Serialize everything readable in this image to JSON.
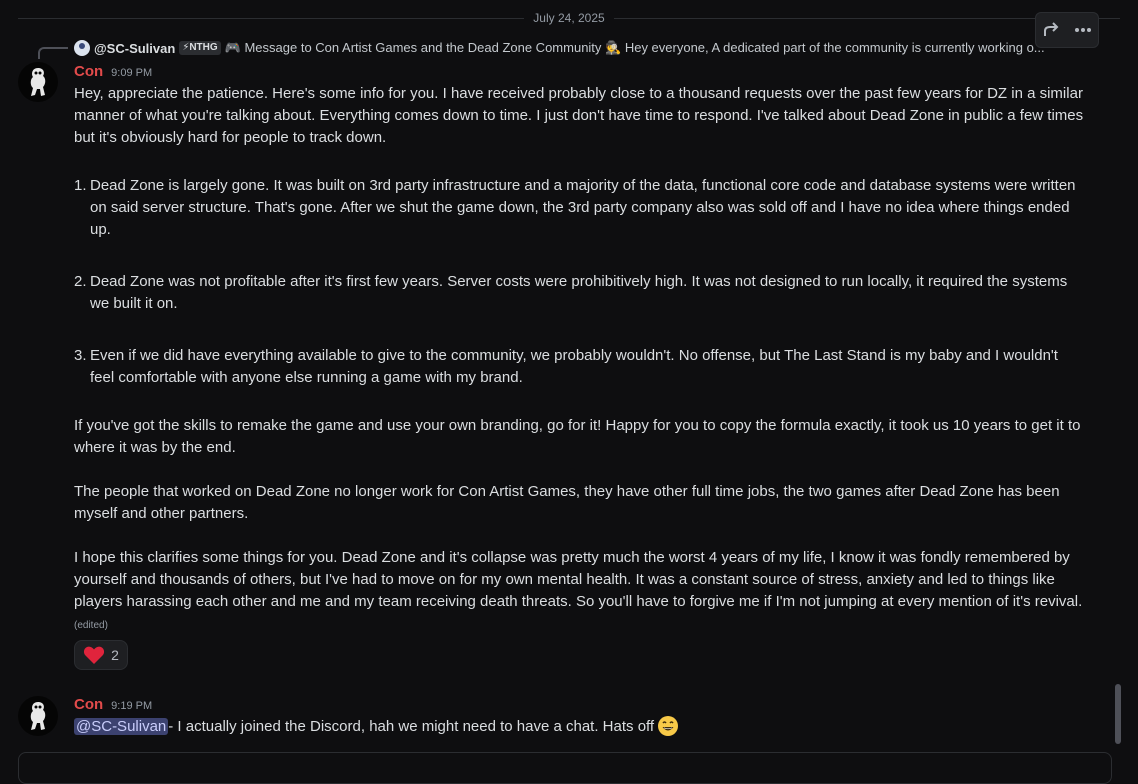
{
  "date_divider": "July 24, 2025",
  "reply": {
    "username": "@SC-Sulivan",
    "tag": "⚡NTHG",
    "text": "🎮 Message to Con Artist Games and the Dead Zone Community 🕵️ Hey everyone,  A dedicated part of the community is currently working o..."
  },
  "message1": {
    "username": "Con",
    "time": "9:09 PM",
    "intro": "Hey, appreciate the patience. Here's some info for you. I have received probably close to a thousand requests over the past few years for DZ in a similar manner of what you're talking about. Everything comes down to time. I just don't have time to respond. I've talked about Dead Zone in public a few times but it's obviously hard for people to track down.",
    "list": [
      {
        "num": "1.",
        "text": "Dead Zone is largely gone. It was built on 3rd party infrastructure and a majority of the data, functional core code and database systems were written on said server structure. That's gone. After we shut the game down, the 3rd party company also was sold off and I have no idea where things ended up."
      },
      {
        "num": "2.",
        "text": "Dead Zone was not profitable after it's first few years. Server costs were prohibitively high. It was not designed to run locally, it required the systems we built it on."
      },
      {
        "num": "3.",
        "text": "Even if we did have everything available to give to the community, we probably wouldn't. No offense, but The Last Stand is my baby and I wouldn't feel comfortable with anyone else running a game with my brand."
      }
    ],
    "p2": "If you've got the skills to remake the game and use your own branding, go for it! Happy for you to copy the formula exactly, it took us 10 years to get it to where it was by the end.",
    "p3": "The people that worked on Dead Zone no longer work for Con Artist Games, they have other full time jobs, the two games after Dead Zone has been myself and other partners.",
    "p4": "I hope this clarifies some things for you. Dead Zone and it's collapse was pretty much the worst 4 years of my life, I know it was fondly remembered by yourself and thousands of others, but I've had to move on for my own mental health. It was a constant source of stress, anxiety and led to things like players harassing each other and me and my team receiving death threats. So you'll have to forgive me if I'm not jumping at every mention of it's revival.",
    "edited": "(edited)",
    "reaction": {
      "emoji": "heart",
      "count": "2"
    }
  },
  "message2": {
    "username": "Con",
    "time": "9:19 PM",
    "mention": "@SC-Sulivan",
    "text": " - I actually joined the Discord, hah we might need to have a chat. Hats off",
    "emoji": "smile"
  },
  "icons": {
    "toolbar": [
      "forward-icon",
      "more-icon"
    ],
    "accent_username": "#e24b4b",
    "mention_bg": "#3c4270"
  }
}
